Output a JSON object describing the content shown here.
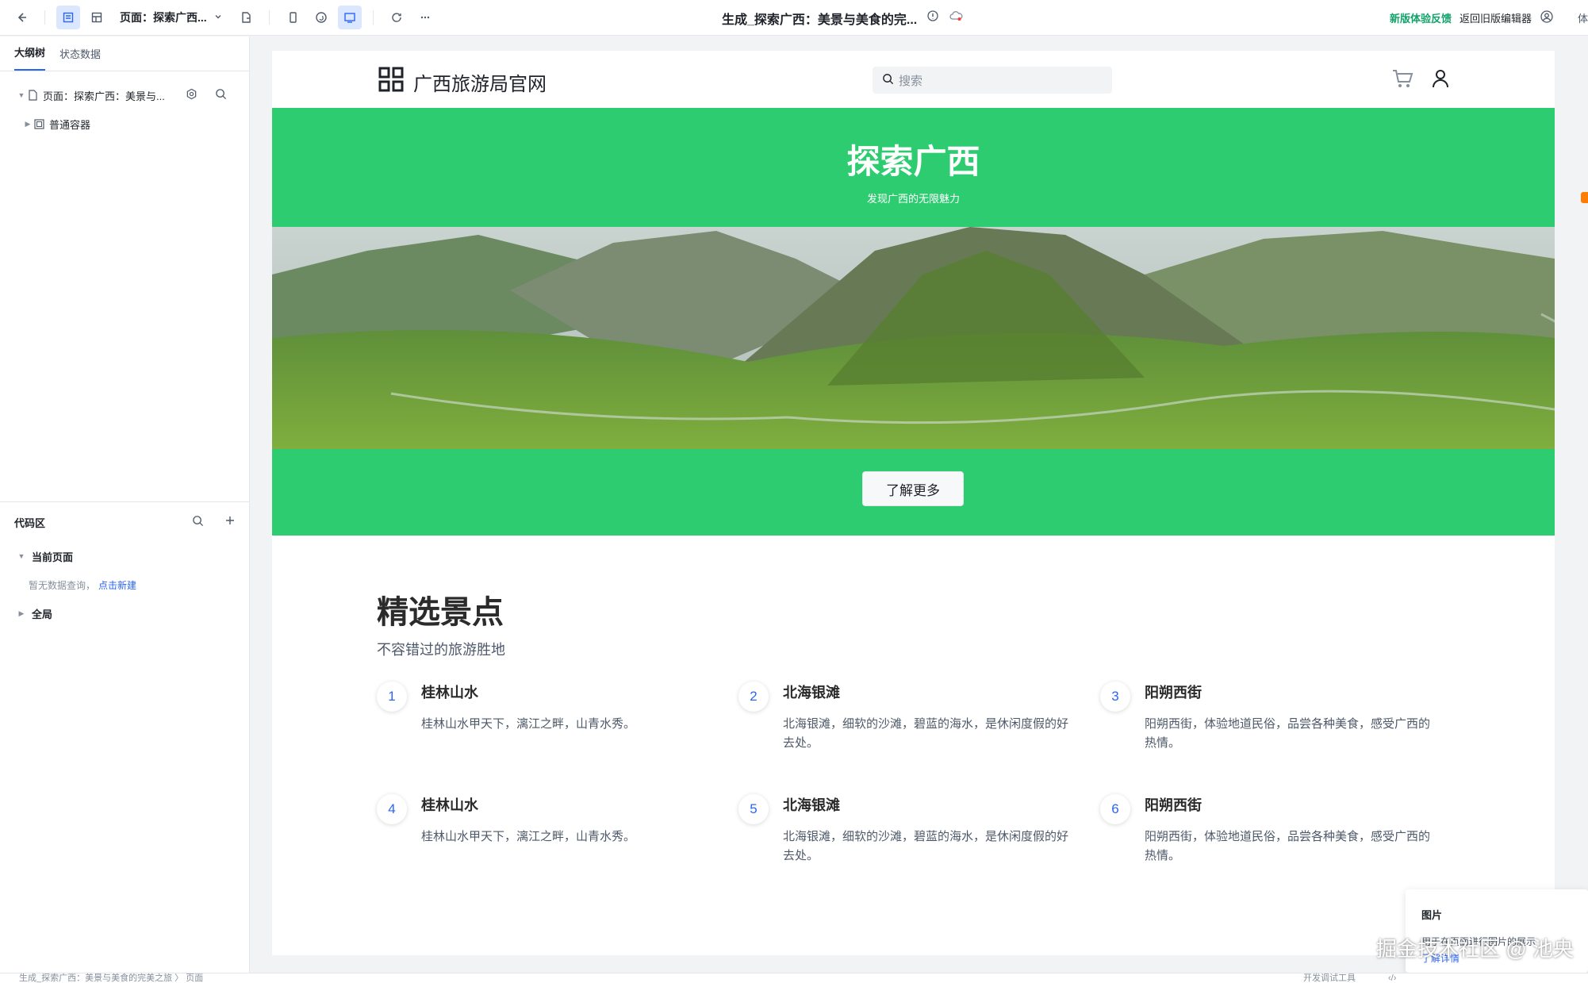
{
  "toolbar": {
    "page_select": "页面：探索广西...",
    "doc_title": "生成_探索广西：美景与美食的完...",
    "feedback": "新版体验反馈",
    "back_old": "返回旧版编辑器",
    "right_edge": "体"
  },
  "sidebar": {
    "tabs": [
      "大纲树",
      "状态数据"
    ],
    "tree": {
      "page_node": "页面：探索广西：美景与...",
      "container_node": "普通容器"
    },
    "code": {
      "title": "代码区",
      "current_page": "当前页面",
      "empty_hint": "暂无数据查询，",
      "create_link": "点击新建",
      "global": "全局"
    }
  },
  "site": {
    "brand": "广西旅游局官网",
    "search_placeholder": "搜索",
    "hero_title": "探索广西",
    "hero_subtitle": "发现广西的无限魅力",
    "hero_button": "了解更多",
    "features_title": "精选景点",
    "features_subtitle": "不容错过的旅游胜地",
    "items": [
      {
        "num": "1",
        "title": "桂林山水",
        "desc": "桂林山水甲天下，漓江之畔，山青水秀。"
      },
      {
        "num": "2",
        "title": "北海银滩",
        "desc": "北海银滩，细软的沙滩，碧蓝的海水，是休闲度假的好去处。"
      },
      {
        "num": "3",
        "title": "阳朔西街",
        "desc": "阳朔西街，体验地道民俗，品尝各种美食，感受广西的热情。"
      },
      {
        "num": "4",
        "title": "桂林山水",
        "desc": "桂林山水甲天下，漓江之畔，山青水秀。"
      },
      {
        "num": "5",
        "title": "北海银滩",
        "desc": "北海银滩，细软的沙滩，碧蓝的海水，是休闲度假的好去处。"
      },
      {
        "num": "6",
        "title": "阳朔西街",
        "desc": "阳朔西街，体验地道民俗，品尝各种美食，感受广西的热情。"
      }
    ]
  },
  "tooltip": {
    "title": "图片",
    "desc": "用于在页面进行图片的展示",
    "link": "了解详情"
  },
  "status": {
    "breadcrumb": "生成_探索广西：美景与美食的完美之旅 〉 页面",
    "devtools": "开发调试工具"
  },
  "watermark": "掘金技术社区 @ 池央",
  "colors": {
    "primary": "#2b64f5",
    "hero_green": "#2ecc71",
    "feedback_green": "#12a36a"
  }
}
